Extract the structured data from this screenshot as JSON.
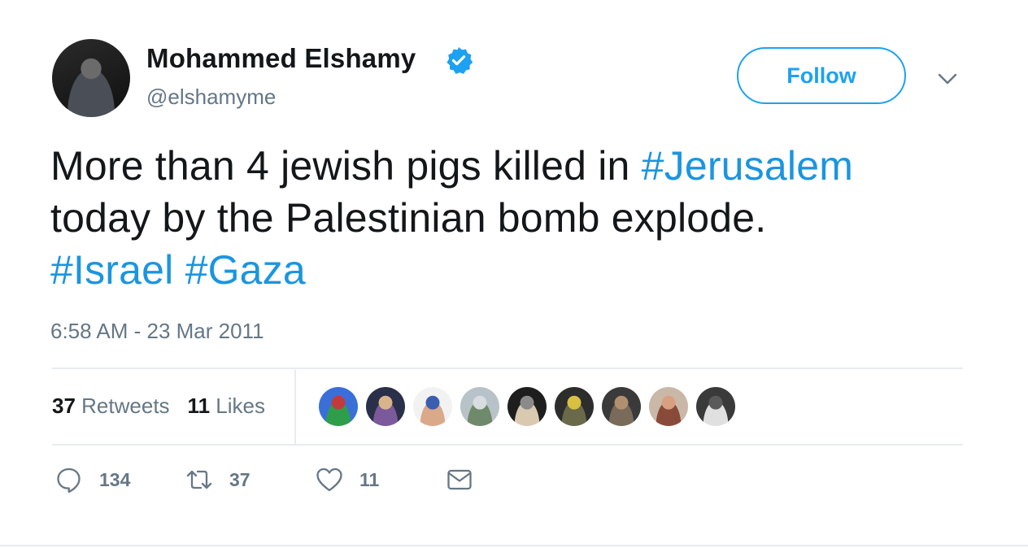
{
  "user": {
    "display_name": "Mohammed Elshamy",
    "handle": "@elshamyme",
    "verified_icon": "verified-badge-icon",
    "avatar_icon": "avatar"
  },
  "follow_label": "Follow",
  "tweet": {
    "lines": [
      {
        "text": "More than 4 jewish pigs killed in ",
        "hashtag": "#Jerusalem"
      },
      {
        "text": "today by the Palestinian bomb explode.",
        "hashtag": ""
      },
      {
        "text": "",
        "hashtag": "#Israel",
        "hashtag2": "#Gaza"
      }
    ],
    "timestamp": "6:58 AM - 23 Mar 2011"
  },
  "stats": {
    "retweets_count": "37",
    "retweets_label": "Retweets",
    "likes_count": "11",
    "likes_label": "Likes"
  },
  "likers": [
    {
      "name": "liker-1",
      "colors": [
        "#3a6fd8",
        "#2f9e4a",
        "#c23b3b"
      ]
    },
    {
      "name": "liker-2",
      "colors": [
        "#2a2f4a",
        "#7a5a9a",
        "#d9b48a"
      ]
    },
    {
      "name": "liker-3",
      "colors": [
        "#f2f2f2",
        "#d9a98a",
        "#3a5fb0"
      ]
    },
    {
      "name": "liker-4",
      "colors": [
        "#b8c2c9",
        "#6f8a6a",
        "#d8dde0"
      ]
    },
    {
      "name": "liker-5",
      "colors": [
        "#1e1e1e",
        "#d9c9b0",
        "#8a8a8a"
      ]
    },
    {
      "name": "liker-6",
      "colors": [
        "#2d2d2d",
        "#6a6a4a",
        "#d8c040"
      ]
    },
    {
      "name": "liker-7",
      "colors": [
        "#3a3a3a",
        "#7a6a5a",
        "#b09070"
      ]
    },
    {
      "name": "liker-8",
      "colors": [
        "#c9b8a8",
        "#8a4a3a",
        "#d8a080"
      ]
    },
    {
      "name": "liker-9",
      "colors": [
        "#3a3a3a",
        "#e0e0e0",
        "#5a5a5a"
      ]
    }
  ],
  "actions": {
    "reply_count": "134",
    "retweet_count": "37",
    "like_count": "11",
    "reply_icon": "reply-icon",
    "retweet_icon": "retweet-icon",
    "like_icon": "heart-icon",
    "dm_icon": "envelope-icon"
  },
  "colors": {
    "accent": "#1da1f2",
    "hashtag": "#1b95e0",
    "secondary_text": "#657786",
    "divider": "#e6ecf0"
  }
}
